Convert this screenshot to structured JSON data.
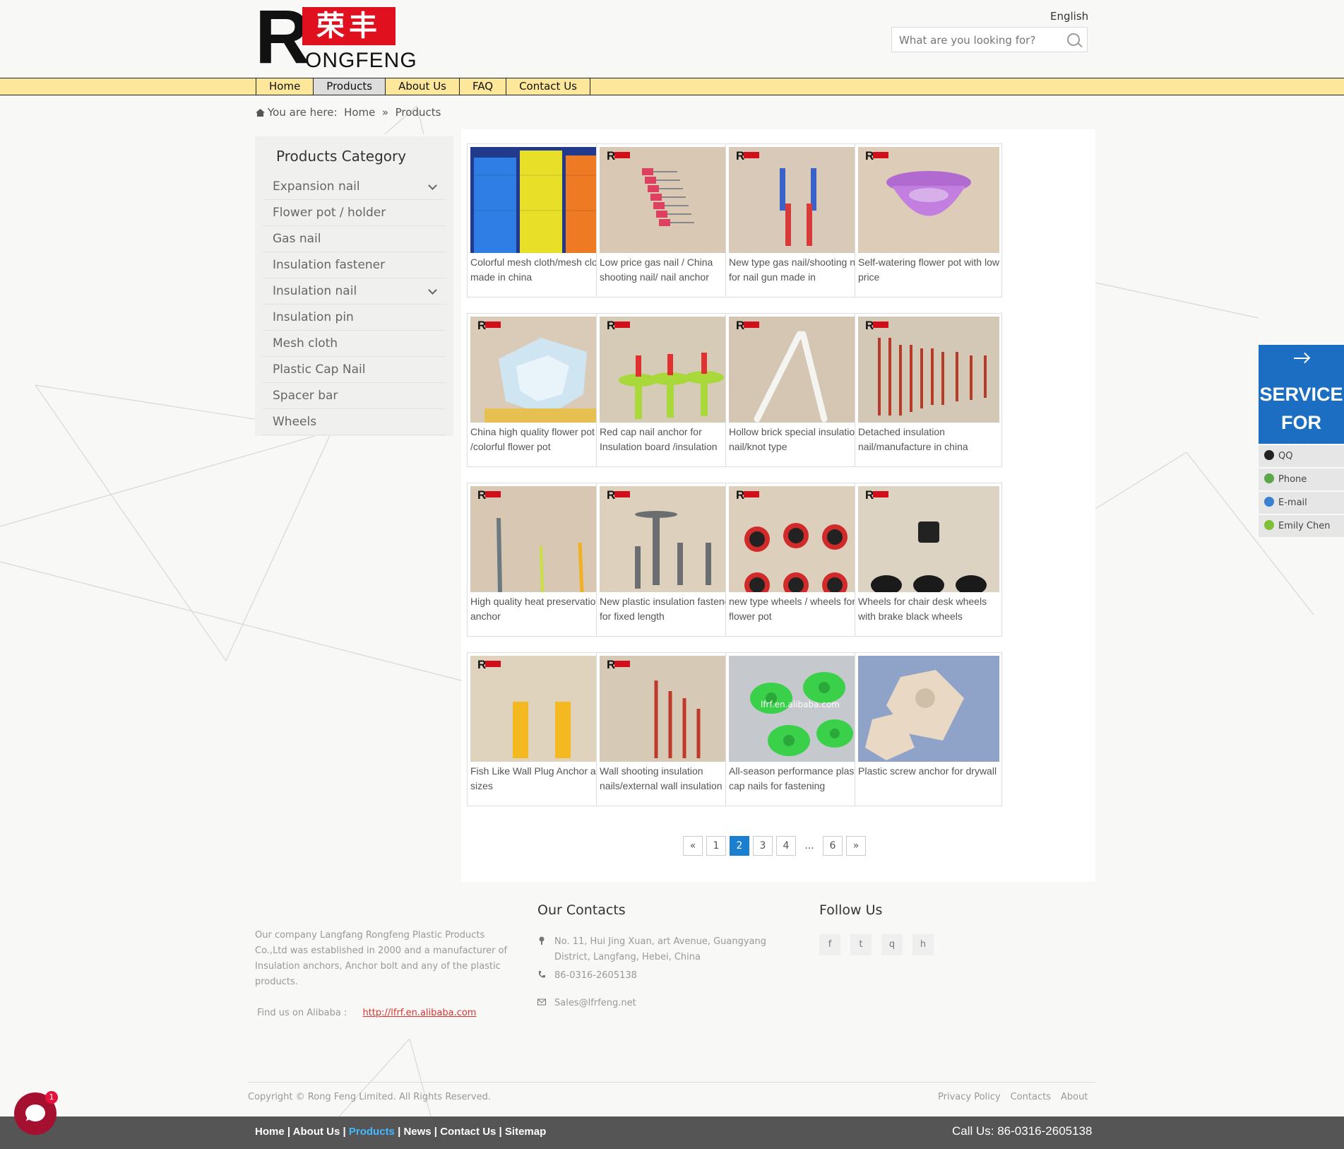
{
  "header": {
    "logo": {
      "mark": "R",
      "chinese": "荣丰",
      "rest": "ONGFENG"
    },
    "language": "English",
    "search_placeholder": "What are you looking for?"
  },
  "nav": [
    "Home",
    "Products",
    "About Us",
    "FAQ",
    "Contact Us"
  ],
  "nav_active": "Products",
  "breadcrumb": {
    "prefix": "You are here:",
    "home": "Home",
    "sep": "»",
    "current": "Products"
  },
  "sidebar": {
    "title": "Products Category",
    "items": [
      {
        "label": "Expansion nail",
        "expandable": true
      },
      {
        "label": "Flower pot / holder",
        "expandable": false
      },
      {
        "label": "Gas nail",
        "expandable": false
      },
      {
        "label": "Insulation fastener",
        "expandable": false
      },
      {
        "label": "Insulation nail",
        "expandable": true
      },
      {
        "label": "Insulation pin",
        "expandable": false
      },
      {
        "label": "Mesh cloth",
        "expandable": false
      },
      {
        "label": "Plastic Cap Nail",
        "expandable": false
      },
      {
        "label": "Spacer bar",
        "expandable": false
      },
      {
        "label": "Wheels",
        "expandable": false
      }
    ]
  },
  "products": [
    {
      "title": "Colorful mesh cloth/mesh cloth made in china",
      "image": "mesh-rolls"
    },
    {
      "title": "Low price gas nail / China shooting nail/ nail anchor",
      "image": "red-gas-nails"
    },
    {
      "title": "New type gas nail/shooting nail for nail gun made in",
      "image": "blue-red-nail-strips"
    },
    {
      "title": "Self-watering flower pot with low price",
      "image": "purple-pot"
    },
    {
      "title": "China high quality flower pot /colorful flower pot",
      "image": "white-hex-pot"
    },
    {
      "title": "Red cap nail anchor for Insulation board /insulation",
      "image": "green-disc-anchors"
    },
    {
      "title": "Hollow brick special insulation nail/knot type",
      "image": "white-long-nails"
    },
    {
      "title": "Detached insulation nail/manufacture in china",
      "image": "red-rods"
    },
    {
      "title": "High quality heat preservation anchor",
      "image": "heat-anchors"
    },
    {
      "title": "New plastic insulation fasteners for fixed length",
      "image": "grey-fasteners"
    },
    {
      "title": "new type wheels / wheels for flower pot",
      "image": "red-wheels"
    },
    {
      "title": "Wheels for chair desk wheels with brake black wheels",
      "image": "black-wheels"
    },
    {
      "title": "Fish Like Wall Plug Anchor all sizes",
      "image": "yellow-plugs"
    },
    {
      "title": "Wall shooting insulation nails/external wall insulation",
      "image": "red-shooting-nails"
    },
    {
      "title": "All-season performance plastic cap nails for fastening",
      "image": "green-cap-nails"
    },
    {
      "title": "Plastic screw anchor for drywall",
      "image": "drywall-anchors"
    }
  ],
  "image_watermark": "lfrf.en.alibaba.com",
  "pagination": {
    "prev": "«",
    "pages": [
      "1",
      "2",
      "3",
      "4"
    ],
    "dots": "...",
    "last": "6",
    "next": "»",
    "current": "2"
  },
  "service": {
    "title_line1": "SERVICE",
    "title_line2": "FOR YOU!",
    "items": [
      {
        "label": "QQ",
        "icon": "qq-icon"
      },
      {
        "label": "Phone",
        "icon": "phone-icon"
      },
      {
        "label": "E-mail",
        "icon": "email-icon"
      },
      {
        "label": "Emily Chen",
        "icon": "chat-icon"
      }
    ]
  },
  "footer": {
    "about": "Our company Langfang Rongfeng Plastic Products Co.,Ltd was established in 2000 and a manufacturer of Insulation anchors, Anchor bolt and any of the plastic products.",
    "alibaba_label": "Find us on Alibaba :",
    "alibaba_link": "http://lfrf.en.alibaba.com",
    "contacts_title": "Our Contacts",
    "address": "No. 11, Hui Jing Xuan, art Avenue, Guangyang District, Langfang, Hebei, China",
    "phone": "86-0316-2605138",
    "email": "Sales@lfrfeng.net",
    "follow_title": "Follow Us",
    "social": [
      "f",
      "t",
      "q",
      "h"
    ],
    "copyright": "Copyright © Rong Feng Limited. All Rights Reserved.",
    "links": [
      "Privacy Policy",
      "Contacts",
      "About"
    ],
    "bottom_links": [
      "Home",
      "About Us",
      "Products",
      "News",
      "Contact Us",
      "Sitemap"
    ],
    "bottom_current": "Products",
    "call": "Call Us: 86-0316-2605138"
  },
  "chat_badge": "1",
  "colors": {
    "nav_bg": "#fce79a",
    "accent_blue": "#1b6ec2",
    "brand_red": "#e0101e",
    "footer_bar": "#555555"
  }
}
